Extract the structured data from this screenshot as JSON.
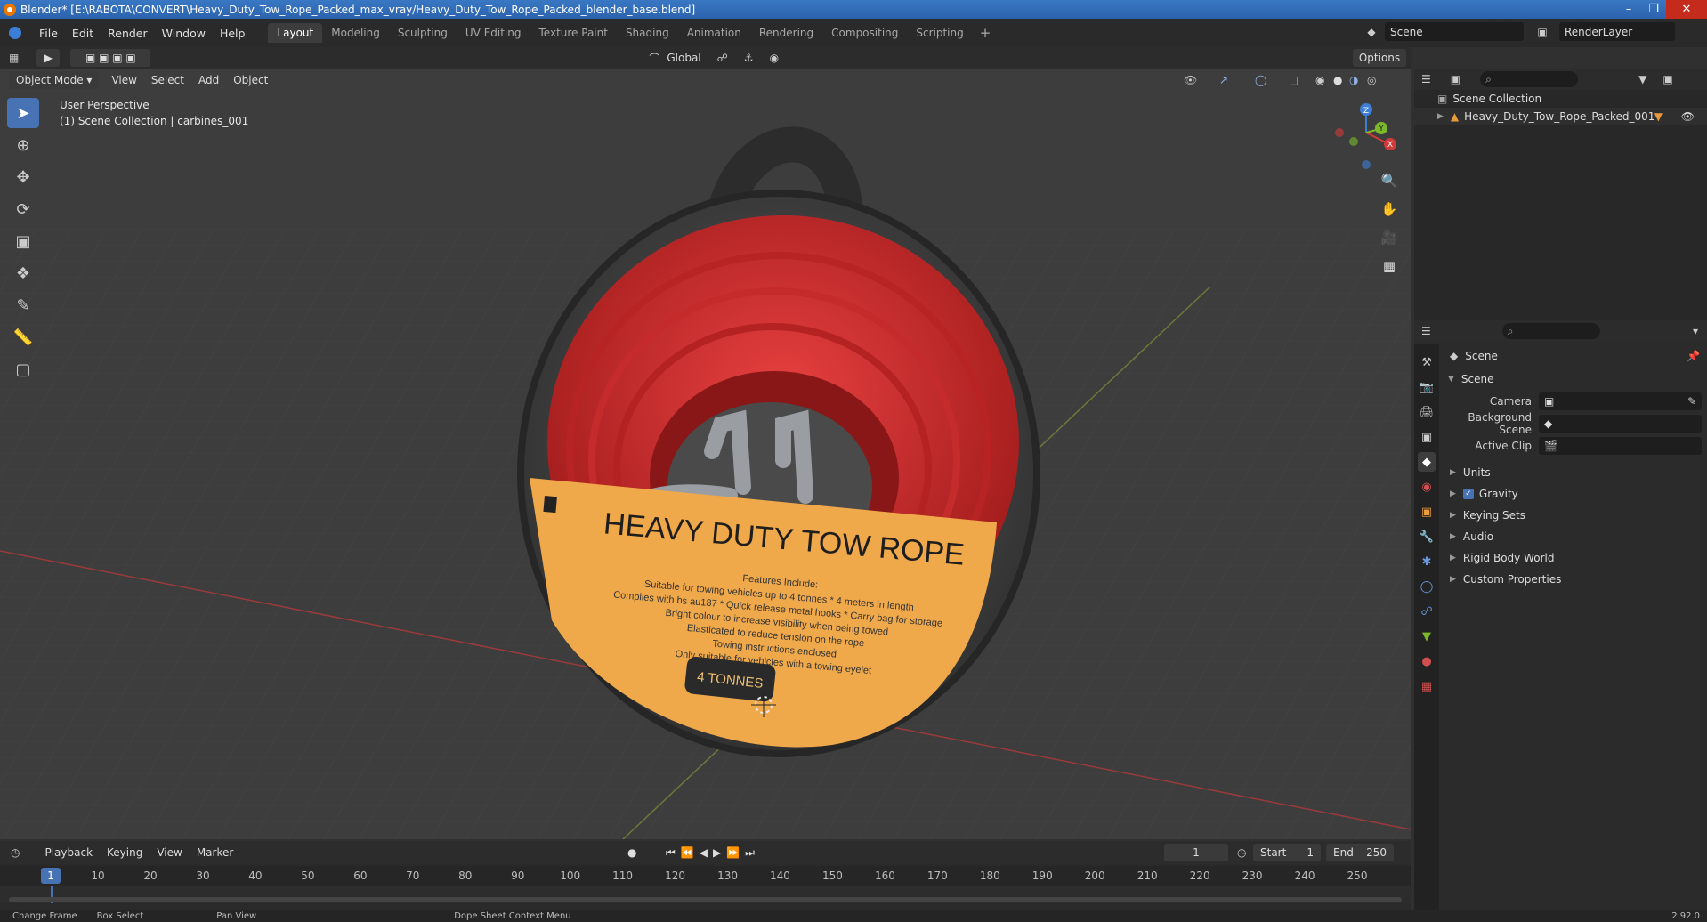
{
  "window": {
    "title": "Blender* [E:\\RABOTA\\CONVERT\\Heavy_Duty_Tow_Rope_Packed_max_vray/Heavy_Duty_Tow_Rope_Packed_blender_base.blend]"
  },
  "menus": [
    "File",
    "Edit",
    "Render",
    "Window",
    "Help"
  ],
  "workspaces": [
    "Layout",
    "Modeling",
    "Sculpting",
    "UV Editing",
    "Texture Paint",
    "Shading",
    "Animation",
    "Rendering",
    "Compositing",
    "Scripting"
  ],
  "workspace_add": "+",
  "scene_name": "Scene",
  "view_layer": "RenderLayer",
  "tool_header": {
    "orientation": "Global",
    "options": "Options"
  },
  "viewport_header": {
    "mode": "Object Mode",
    "menus": [
      "View",
      "Select",
      "Add",
      "Object"
    ]
  },
  "viewport": {
    "perspective": "User Perspective",
    "context": "(1) Scene Collection | carbines_001"
  },
  "gizmo": {
    "z": "Z",
    "y": "Y",
    "x": "X"
  },
  "product_label": {
    "title": "HEAVY DUTY TOW ROPE",
    "features_title": "Features Include:",
    "lines": [
      "Suitable for towing vehicles up to 4 tonnes * 4 meters in length",
      "Complies with bs au187 * Quick release metal hooks * Carry bag for storage",
      "Bright colour to increase visibility when being towed",
      "Elasticated to reduce tension on the rope",
      "Towing instructions enclosed",
      "Only suitable for vehicles with a towing eyelet"
    ],
    "badge": "4 TONNES"
  },
  "outliner": {
    "root": "Scene Collection",
    "items": [
      {
        "label": "Heavy_Duty_Tow_Rope_Packed_001"
      }
    ]
  },
  "properties": {
    "context": "Scene",
    "panel": "Scene",
    "rows": [
      {
        "label": "Camera",
        "value": ""
      },
      {
        "label": "Background Scene",
        "value": ""
      },
      {
        "label": "Active Clip",
        "value": ""
      }
    ],
    "subpanels": [
      "Units",
      "Gravity",
      "Keying Sets",
      "Audio",
      "Rigid Body World",
      "Custom Properties"
    ]
  },
  "timeline": {
    "menus": [
      "Playback",
      "Keying",
      "View",
      "Marker"
    ],
    "current_frame": "1",
    "start_label": "Start",
    "start": "1",
    "end_label": "End",
    "end": "250",
    "ruler": [
      "1",
      "10",
      "20",
      "30",
      "40",
      "50",
      "60",
      "70",
      "80",
      "90",
      "100",
      "110",
      "120",
      "130",
      "140",
      "150",
      "160",
      "170",
      "180",
      "190",
      "200",
      "210",
      "220",
      "230",
      "240",
      "250"
    ]
  },
  "statusbar": {
    "items": [
      "Change Frame",
      "Box Select",
      "Pan View",
      "Dope Sheet Context Menu"
    ],
    "version": "2.92.0"
  },
  "colors": {
    "accent": "#4772b3",
    "rope": "#d42a2a",
    "label": "#f0a94a",
    "titlebar": "#2b62ad"
  }
}
